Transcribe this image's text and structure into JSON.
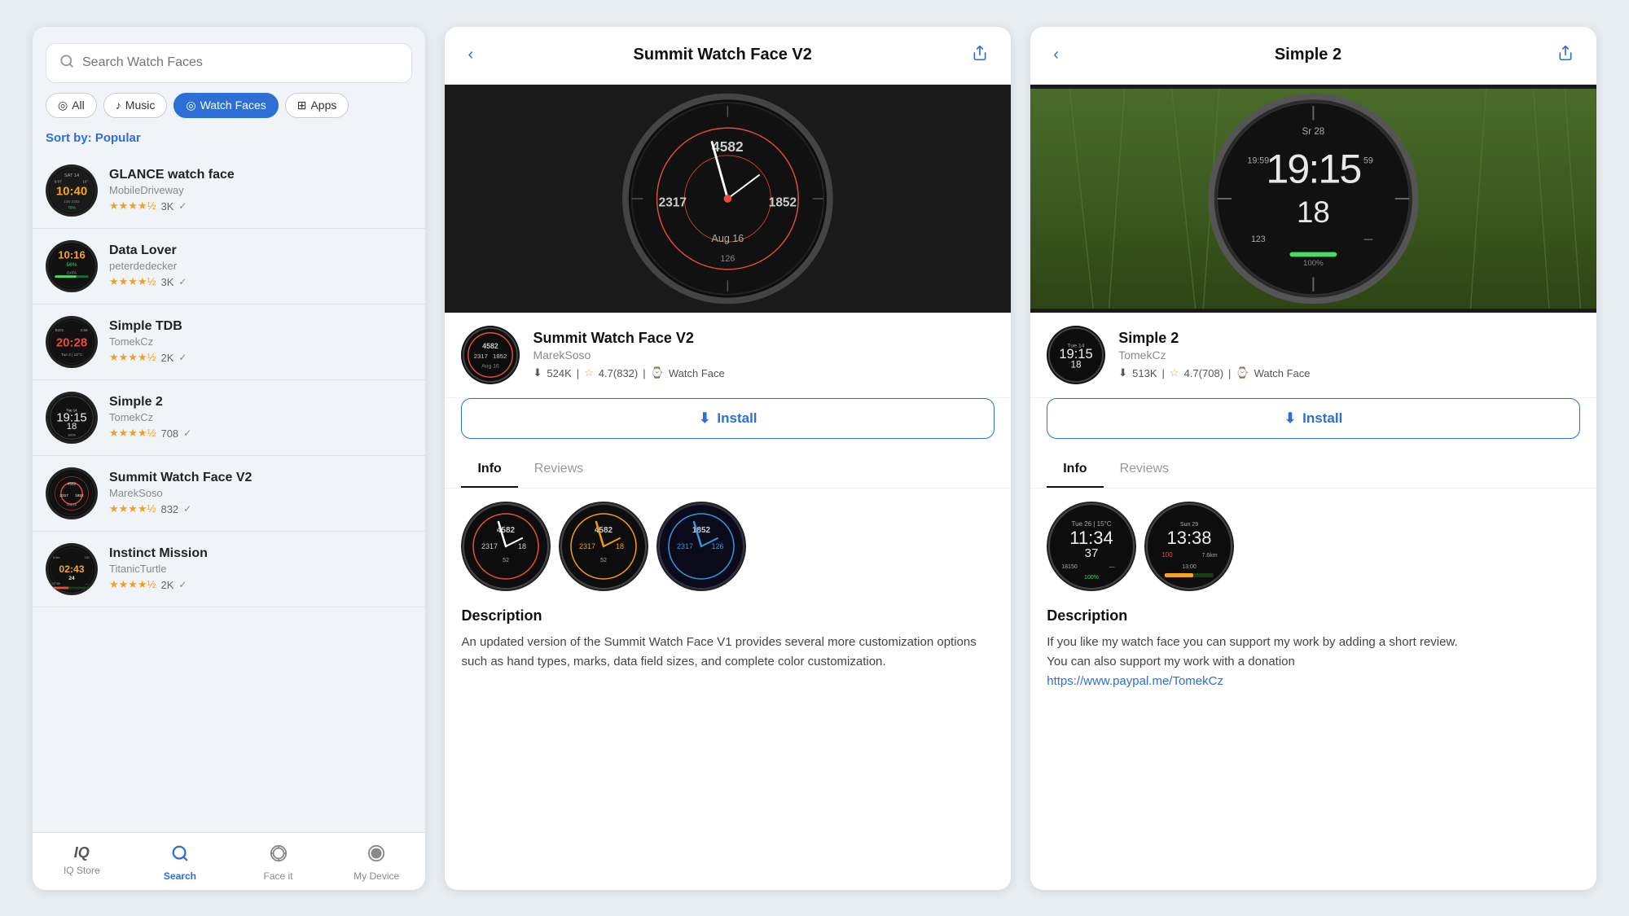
{
  "search": {
    "placeholder": "Search Watch Faces"
  },
  "filters": [
    {
      "id": "all",
      "label": "All",
      "icon": "◎",
      "active": false
    },
    {
      "id": "music",
      "label": "Music",
      "icon": "♪",
      "active": false
    },
    {
      "id": "watchfaces",
      "label": "Watch Faces",
      "icon": "◎",
      "active": true
    },
    {
      "id": "apps",
      "label": "Apps",
      "icon": "⊞",
      "active": false
    }
  ],
  "sort": {
    "prefix": "Sort by:",
    "value": "Popular"
  },
  "list_items": [
    {
      "name": "GLANCE watch face",
      "author": "MobileDriveway",
      "rating": "3K",
      "stars": 4.5,
      "id": "glance"
    },
    {
      "name": "Data Lover",
      "author": "peterdedecker",
      "rating": "3K",
      "stars": 4.5,
      "id": "datalover"
    },
    {
      "name": "Simple TDB",
      "author": "TomekCz",
      "rating": "2K",
      "stars": 4.5,
      "id": "simpletdb"
    },
    {
      "name": "Simple 2",
      "author": "TomekCz",
      "rating": "708",
      "stars": 4.5,
      "id": "simple2"
    },
    {
      "name": "Summit Watch Face V2",
      "author": "MarekSoso",
      "rating": "832",
      "stars": 4.5,
      "id": "summit"
    },
    {
      "name": "Instinct Mission",
      "author": "TitanicTurtle",
      "rating": "2K",
      "stars": 4.5,
      "id": "instinct"
    }
  ],
  "bottom_nav": [
    {
      "id": "iqstore",
      "label": "IQ Store",
      "icon": "IQ",
      "active": false
    },
    {
      "id": "search",
      "label": "Search",
      "icon": "🔍",
      "active": true
    },
    {
      "id": "faceit",
      "label": "Face it",
      "icon": "⌚",
      "active": false
    },
    {
      "id": "mydevice",
      "label": "My Device",
      "icon": "●",
      "active": false
    }
  ],
  "middle": {
    "title": "Summit Watch Face V2",
    "author": "MarekSoso",
    "downloads": "524K",
    "rating": "4.7",
    "rating_count": "832",
    "type": "Watch Face",
    "install_label": "Install",
    "active_tab": "Info",
    "tabs": [
      "Info",
      "Reviews"
    ],
    "description_title": "Description",
    "description": "An updated version of the Summit Watch Face V1 provides several more customization options such as hand types, marks, data field sizes, and complete color customization."
  },
  "right": {
    "title": "Simple 2",
    "author": "TomekCz",
    "downloads": "513K",
    "rating": "4.7",
    "rating_count": "708",
    "type": "Watch Face",
    "install_label": "Install",
    "active_tab": "Info",
    "tabs": [
      "Info",
      "Reviews"
    ],
    "description_title": "Description",
    "description_line1": "If you like my watch face you can support my work by adding a short review.",
    "description_line2": "You can also support my work with a donation",
    "description_link": "https://www.paypal.me/TomekCz"
  }
}
